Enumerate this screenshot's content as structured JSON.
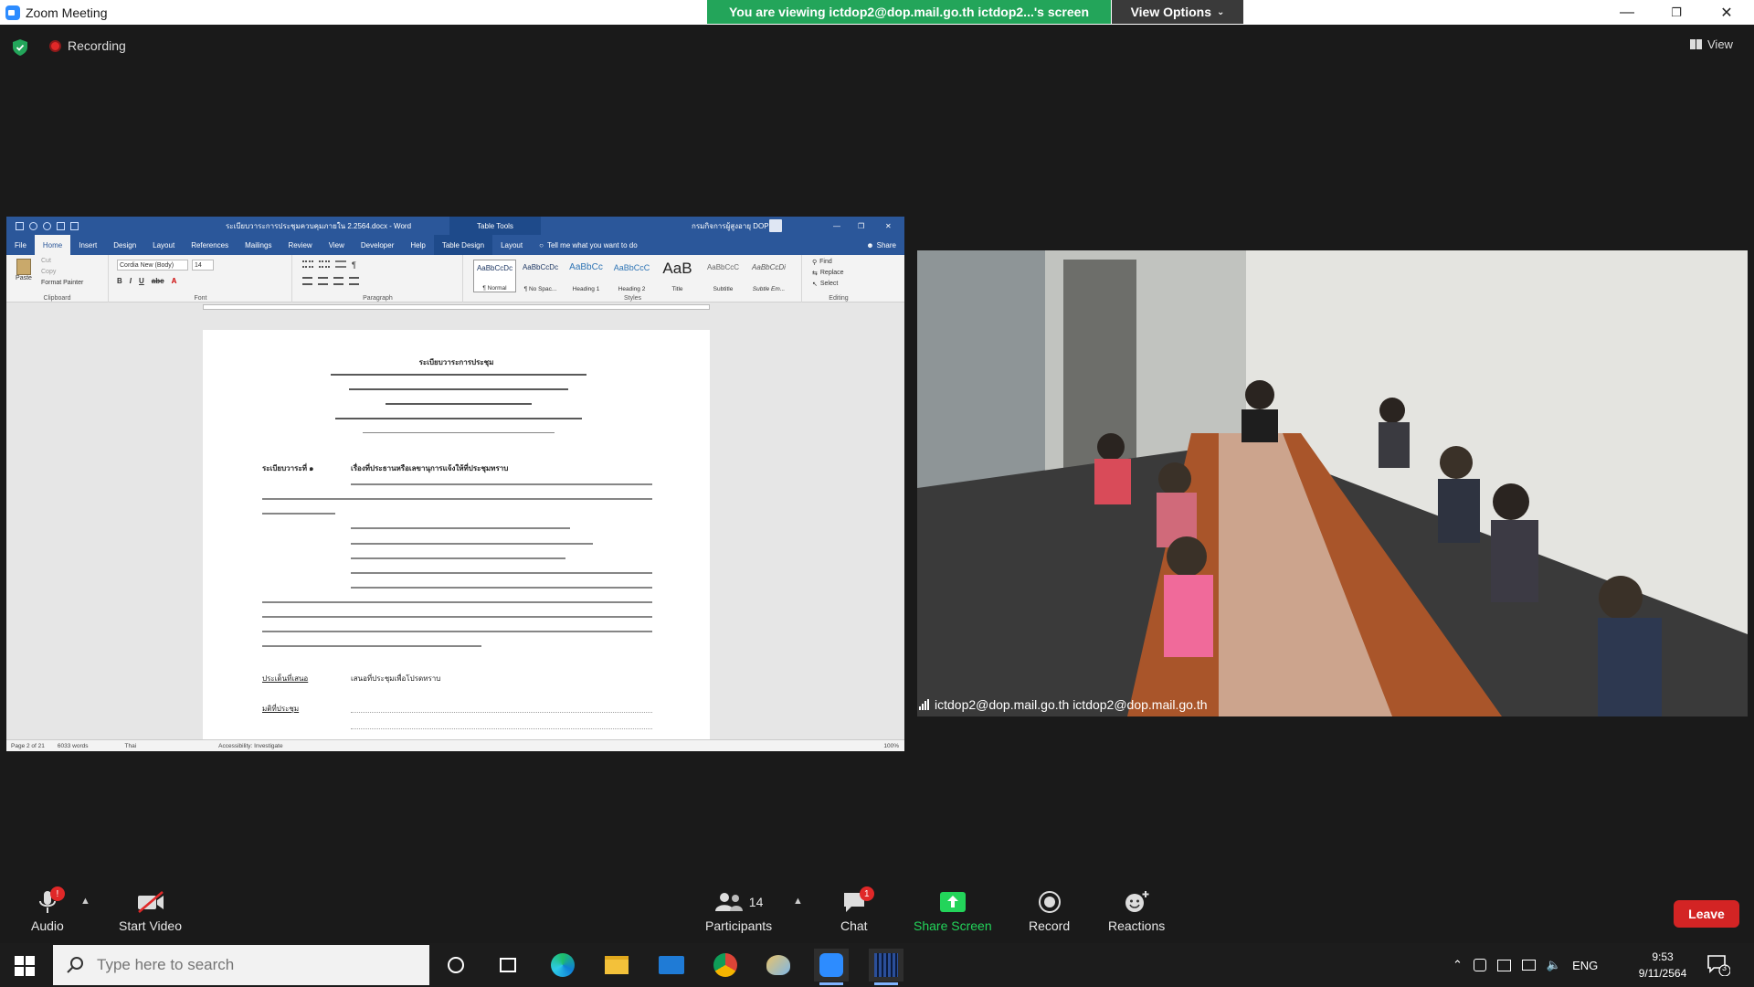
{
  "window": {
    "title": "Zoom Meeting"
  },
  "share_banner": {
    "text": "You are viewing ictdop2@dop.mail.go.th ictdop2...'s screen"
  },
  "view_options": {
    "label": "View Options"
  },
  "recording": {
    "label": "Recording"
  },
  "view": {
    "label": "View"
  },
  "word": {
    "title": "ระเบียบวาระการประชุมควบคุมภายใน 2.2564.docx - Word",
    "table_tools": "Table Tools",
    "user": "กรมกิจการผู้สูงอายุ DOP",
    "tabs": [
      "File",
      "Home",
      "Insert",
      "Design",
      "Layout",
      "References",
      "Mailings",
      "Review",
      "View",
      "Developer",
      "Help",
      "Table Design",
      "Layout"
    ],
    "tell_me": "Tell me what you want to do",
    "share": "Share",
    "clipboard": {
      "paste": "Paste",
      "cut": "Cut",
      "copy": "Copy",
      "format_painter": "Format Painter",
      "group": "Clipboard"
    },
    "font": {
      "name": "Cordia New (Body)",
      "size": "14",
      "group": "Font"
    },
    "paragraph_group": "Paragraph",
    "styles": [
      {
        "preview": "AaBbCcDc",
        "name": "¶ Normal"
      },
      {
        "preview": "AaBbCcDc",
        "name": "¶ No Spac..."
      },
      {
        "preview": "AaBbCc",
        "name": "Heading 1"
      },
      {
        "preview": "AaBbCcC",
        "name": "Heading 2"
      },
      {
        "preview": "AaB",
        "name": "Title"
      },
      {
        "preview": "AaBbCcC",
        "name": "Subtitle"
      },
      {
        "preview": "AaBbCcDi",
        "name": "Subtle Em..."
      }
    ],
    "styles_group": "Styles",
    "editing": {
      "find": "Find",
      "replace": "Replace",
      "select": "Select",
      "group": "Editing"
    },
    "status": {
      "page": "Page 2 of 21",
      "words": "6033 words",
      "lang": "Thai",
      "accessibility": "Accessibility: Investigate",
      "zoom": "100%"
    },
    "doc": {
      "heading": "ระเบียบวาระการประชุม",
      "agenda_label": "ระเบียบวาระที่ ๑",
      "agenda_title": "เรื่องที่ประธานหรือเลขานุการแจ้งให้ที่ประชุมทราบ",
      "proposal_label": "ประเด็นที่เสนอ",
      "proposal_text": "เสนอที่ประชุมเพื่อโปรดทราบ",
      "resolution_label": "มติที่ประชุม"
    }
  },
  "video": {
    "participant": "ictdop2@dop.mail.go.th ictdop2@dop.mail.go.th"
  },
  "toolbar": {
    "audio": "Audio",
    "audio_badge": "!",
    "start_video": "Start Video",
    "participants": "Participants",
    "participants_count": "14",
    "chat": "Chat",
    "chat_badge": "1",
    "share_screen": "Share Screen",
    "record": "Record",
    "reactions": "Reactions",
    "leave": "Leave"
  },
  "taskbar": {
    "search_placeholder": "Type here to search",
    "lang": "ENG",
    "time": "9:53",
    "date": "9/11/2564",
    "notif_count": "3"
  },
  "colors": {
    "zoom_blue": "#2d8cff",
    "banner_green": "#23a55a",
    "leave_red": "#d32424",
    "word_blue": "#2b579a",
    "share_green": "#23d45a"
  }
}
